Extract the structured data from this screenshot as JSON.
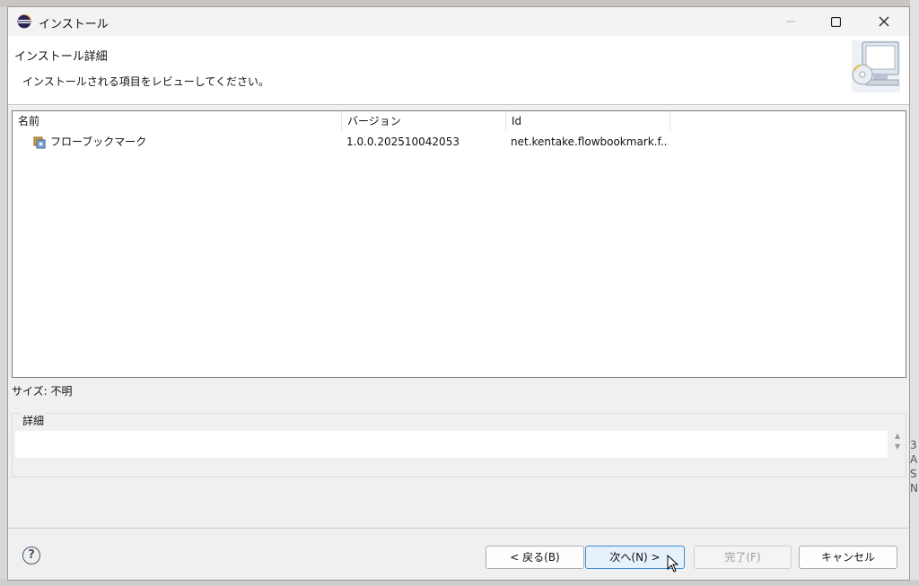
{
  "window": {
    "title": "インストール"
  },
  "header": {
    "title": "インストール詳細",
    "description": "インストールされる項目をレビューしてください。"
  },
  "table": {
    "columns": [
      "名前",
      "バージョン",
      "Id"
    ],
    "rows": [
      {
        "name": "フローブックマーク",
        "version": "1.0.0.202510042053",
        "id": "net.kentake.flowbookmark.f..."
      }
    ]
  },
  "size_label": "サイズ: 不明",
  "details": {
    "legend": "詳細",
    "text": ""
  },
  "buttons": {
    "back": "< 戻る(B)",
    "next": "次へ(N) >",
    "finish": "完了(F)",
    "cancel": "キャンセル"
  },
  "background_text": [
    "3",
    "A",
    "S",
    "N"
  ],
  "colors": {
    "accent_border": "#3d8fd6",
    "accent_fill": "#e5f1fb"
  }
}
